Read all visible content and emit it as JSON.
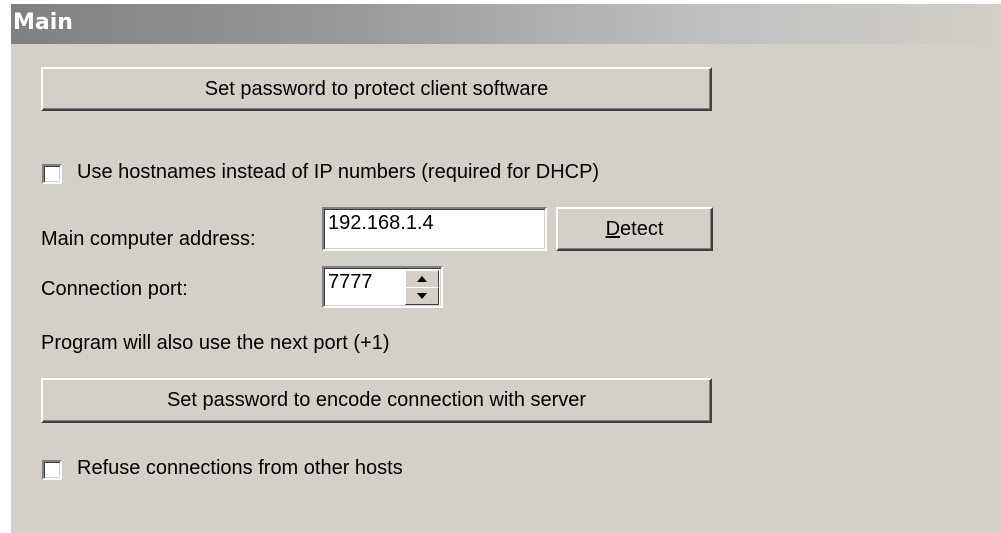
{
  "header": {
    "title": "Main"
  },
  "buttons": {
    "set_client_password": "Set password to protect client software",
    "detect_mnemonic": "D",
    "detect_rest": "etect",
    "set_encode_password": "Set password to encode connection with server"
  },
  "options": {
    "use_hostnames_label": "Use hostnames  instead of IP numbers  (required for DHCP)",
    "use_hostnames_checked": false,
    "refuse_connections_label": "Refuse connections from other hosts",
    "refuse_connections_checked": false
  },
  "fields": {
    "address_label": "Main computer address:",
    "address_value": "192.168.1.4",
    "port_label": "Connection port:",
    "port_value": "7777"
  },
  "notes": {
    "next_port": "Program will also use the next port (+1)"
  },
  "icons": {
    "spin_up": "triangle-up-icon",
    "spin_down": "triangle-down-icon"
  },
  "colors": {
    "panel_bg": "#d4d0c8",
    "header_dark": "#808080",
    "header_light": "#d4d0c8",
    "header_text": "#ffffff"
  }
}
